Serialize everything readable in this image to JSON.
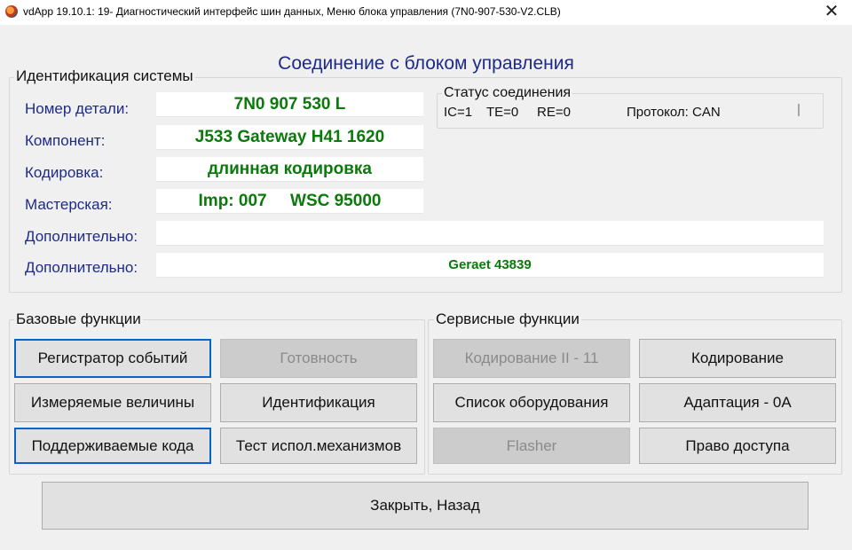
{
  "window": {
    "title": "vdApp 19.10.1: 19- Диагностический интерфейс шин данных,  Меню блока управления (7N0-907-530-V2.CLB)"
  },
  "header": {
    "title": "Соединение с блоком управления"
  },
  "identification": {
    "group_label": "Идентификация системы",
    "fields": [
      {
        "label": "Номер детали:",
        "value": "7N0 907 530 L"
      },
      {
        "label": "Компонент:",
        "value": "J533  Gateway H41 1620"
      },
      {
        "label": "Кодировка:",
        "value": "длинная кодировка"
      },
      {
        "label": "Мастерская:",
        "value": "Imp: 007     WSC 95000"
      },
      {
        "label": "Дополнительно:",
        "value": ""
      },
      {
        "label": "Дополнительно:",
        "value": "Geraet 43839"
      }
    ]
  },
  "connection_status": {
    "group_label": "Статус соединения",
    "ic": "IC=1",
    "te": "TE=0",
    "re": "RE=0",
    "protocol": "Протокол: CAN",
    "indicator": "|"
  },
  "basic_functions": {
    "group_label": "Базовые функции",
    "buttons": [
      {
        "label": "Регистратор событий",
        "enabled": true
      },
      {
        "label": "Готовность",
        "enabled": false
      },
      {
        "label": "Измеряемые величины",
        "enabled": true
      },
      {
        "label": "Идентификация",
        "enabled": true
      },
      {
        "label": "Поддерживаемые кода",
        "enabled": true
      },
      {
        "label": "Тест испол.механизмов",
        "enabled": true
      }
    ]
  },
  "service_functions": {
    "group_label": "Сервисные функции",
    "buttons": [
      {
        "label": "Кодирование II - 11",
        "enabled": false
      },
      {
        "label": "Кодирование",
        "enabled": true
      },
      {
        "label": "Список оборудования",
        "enabled": true
      },
      {
        "label": "Адаптация - 0A",
        "enabled": true
      },
      {
        "label": "Flasher",
        "enabled": false
      },
      {
        "label": "Право доступа",
        "enabled": true
      }
    ]
  },
  "footer": {
    "close_label": "Закрыть, Назад"
  }
}
